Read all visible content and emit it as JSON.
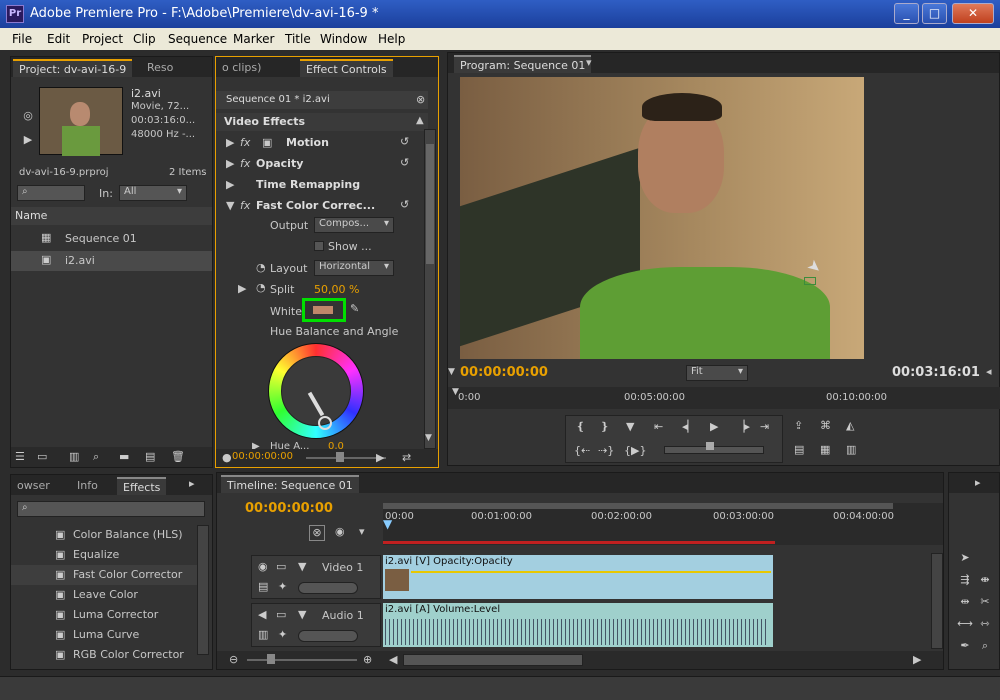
{
  "window": {
    "app_icon": "Pr",
    "title": "Adobe Premiere Pro - F:\\Adobe\\Premiere\\dv-avi-16-9 *",
    "minimize": "_",
    "maximize": "□",
    "close": "✕"
  },
  "menu": [
    "File",
    "Edit",
    "Project",
    "Clip",
    "Sequence",
    "Marker",
    "Title",
    "Window",
    "Help"
  ],
  "project_panel": {
    "tabs": [
      "Project: dv-avi-16-9",
      "Reso",
      "o clips)"
    ],
    "clip_name": "i2.avi",
    "clip_type": "Movie, 72...",
    "clip_duration": "00:03:16:0...",
    "clip_audio": "48000 Hz -...",
    "project_file": "dv-avi-16-9.prproj",
    "item_count": "2 Items",
    "in_label": "In:",
    "in_value": "All",
    "column_name": "Name",
    "items": [
      "Sequence 01",
      "i2.avi"
    ]
  },
  "effect_controls": {
    "tab": "Effect Controls",
    "sequence_clip": "Sequence 01 * i2.avi",
    "section": "Video Effects",
    "effects": [
      "Motion",
      "Opacity",
      "Time Remapping",
      "Fast Color Correc..."
    ],
    "output_label": "Output",
    "output_value": "Compos...",
    "show_label": "Show ...",
    "layout_label": "Layout",
    "layout_value": "Horizontal",
    "split_label": "Split",
    "split_value": "50,00 %",
    "white_label": "White",
    "hue_label": "Hue Balance and Angle",
    "hue_row_label": "Hue A...",
    "hue_row_value": "0,0",
    "timecode": "00:00:00:00"
  },
  "program_monitor": {
    "tab": "Program: Sequence 01",
    "timecode_current": "00:00:00:00",
    "fit_label": "Fit",
    "timecode_duration": "00:03:16:01",
    "ruler": [
      "0:00",
      "00:05:00:00",
      "00:10:00:00"
    ]
  },
  "effects_panel": {
    "tabs": [
      "owser",
      "Info",
      "Effects"
    ],
    "items": [
      "Color Balance (HLS)",
      "Equalize",
      "Fast Color Corrector",
      "Leave Color",
      "Luma Corrector",
      "Luma Curve",
      "RGB Color Corrector"
    ]
  },
  "timeline": {
    "tab": "Timeline: Sequence 01",
    "timecode": "00:00:00:00",
    "ruler": [
      "00:00",
      "00:01:00:00",
      "00:02:00:00",
      "00:03:00:00",
      "00:04:00:00"
    ],
    "video_track": "Video 1",
    "audio_track": "Audio 1",
    "video_clip": "i2.avi [V]  Opacity:Opacity",
    "audio_clip": "i2.avi [A]  Volume:Level"
  },
  "colors": {
    "accent": "#e8a000",
    "video_clip": "#a3cfe0",
    "audio_clip": "#9fd0cc",
    "highlight": "#00e000"
  }
}
